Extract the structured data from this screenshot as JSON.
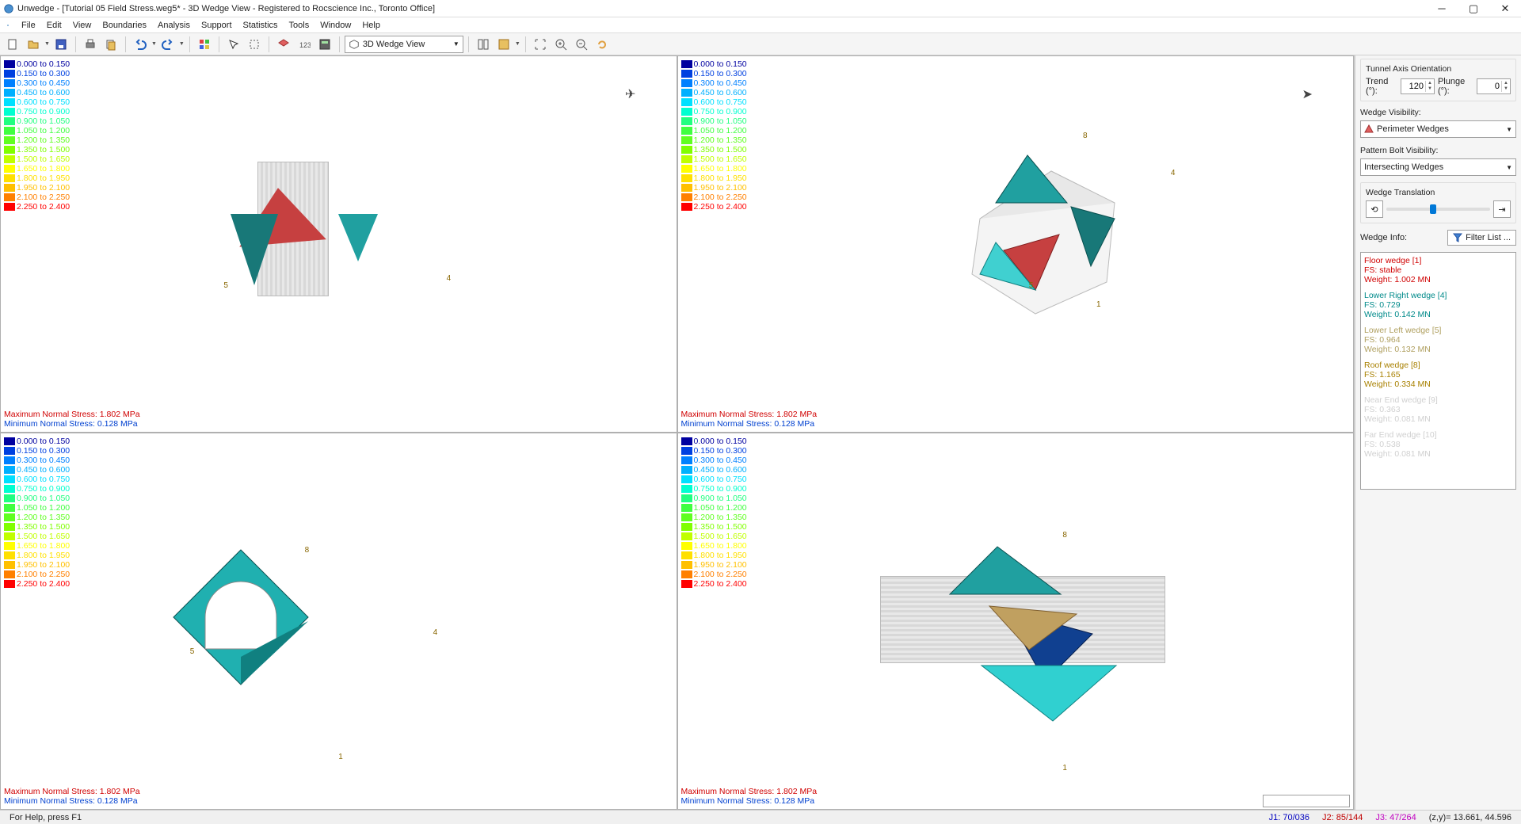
{
  "title": "Unwedge - [Tutorial 05 Field Stress.weg5* - 3D Wedge View - Registered to Rocscience Inc., Toronto Office]",
  "menus": [
    "File",
    "Edit",
    "View",
    "Boundaries",
    "Analysis",
    "Support",
    "Statistics",
    "Tools",
    "Window",
    "Help"
  ],
  "view_selector": "3D Wedge View",
  "legend": [
    {
      "c": "#0000a0",
      "t": "0.000 to 0.150"
    },
    {
      "c": "#0040e0",
      "t": "0.150 to 0.300"
    },
    {
      "c": "#0080ff",
      "t": "0.300 to 0.450"
    },
    {
      "c": "#00b0ff",
      "t": "0.450 to 0.600"
    },
    {
      "c": "#00e0ff",
      "t": "0.600 to 0.750"
    },
    {
      "c": "#00ffd0",
      "t": "0.750 to 0.900"
    },
    {
      "c": "#20ff80",
      "t": "0.900 to 1.050"
    },
    {
      "c": "#40ff40",
      "t": "1.050 to 1.200"
    },
    {
      "c": "#60ff20",
      "t": "1.200 to 1.350"
    },
    {
      "c": "#80ff00",
      "t": "1.350 to 1.500"
    },
    {
      "c": "#c0ff00",
      "t": "1.500 to 1.650"
    },
    {
      "c": "#ffff00",
      "t": "1.650 to 1.800"
    },
    {
      "c": "#ffe000",
      "t": "1.800 to 1.950"
    },
    {
      "c": "#ffc000",
      "t": "1.950 to 2.100"
    },
    {
      "c": "#ff8000",
      "t": "2.100 to 2.250"
    },
    {
      "c": "#ff0000",
      "t": "2.250 to 2.400"
    }
  ],
  "stress": {
    "max": "Maximum Normal Stress: 1.802 MPa",
    "min": "Minimum Normal Stress: 0.128 MPa"
  },
  "right": {
    "orientation_header": "Tunnel Axis Orientation",
    "trend_label": "Trend (°):",
    "trend_value": "120",
    "plunge_label": "Plunge (°):",
    "plunge_value": "0",
    "wedge_vis_label": "Wedge Visibility:",
    "wedge_vis_value": "Perimeter Wedges",
    "bolt_vis_label": "Pattern Bolt Visibility:",
    "bolt_vis_value": "Intersecting Wedges",
    "translation_label": "Wedge Translation",
    "wedge_info_label": "Wedge Info:",
    "filter_btn": "Filter List ...",
    "wedges": [
      {
        "color": "#d00000",
        "name": "Floor wedge [1]",
        "l2": "FS: stable",
        "l3": "Weight: 1.002 MN"
      },
      {
        "color": "#008a8a",
        "name": "Lower Right wedge [4]",
        "l2": "FS: 0.729",
        "l3": "Weight: 0.142 MN"
      },
      {
        "color": "#b0a060",
        "name": "Lower Left wedge [5]",
        "l2": "FS: 0.964",
        "l3": "Weight: 0.132 MN"
      },
      {
        "color": "#a88000",
        "name": "Roof wedge [8]",
        "l2": "FS: 1.165",
        "l3": "Weight: 0.334 MN"
      },
      {
        "color": "#d0d0d0",
        "name": "Near End wedge [9]",
        "l2": "FS: 0.363",
        "l3": "Weight: 0.081 MN"
      },
      {
        "color": "#d0d0d0",
        "name": "Far End wedge [10]",
        "l2": "FS: 0.538",
        "l3": "Weight: 0.081 MN"
      }
    ]
  },
  "status": {
    "help": "For Help, press F1",
    "j1": "J1: 70/036",
    "j2": "J2: 85/144",
    "j3": "J3: 47/264",
    "coord": "(z,y)=  13.661, 44.596"
  }
}
